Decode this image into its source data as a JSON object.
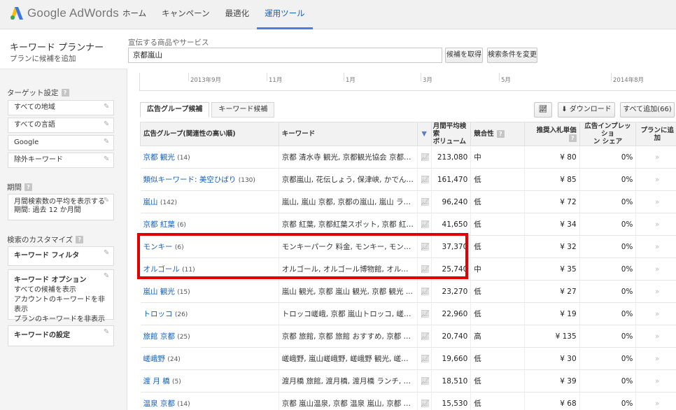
{
  "app": {
    "brand": "Google AdWords"
  },
  "nav": [
    "ホーム",
    "キャンペーン",
    "最適化",
    "運用ツール"
  ],
  "header": {
    "title": "キーワード プランナー",
    "subtitle": "プランに候補を追加",
    "search_label": "宣伝する商品やサービス",
    "search_value": "京都嵐山",
    "btn_get": "候補を取得",
    "btn_modify": "検索条件を変更"
  },
  "sidebar": {
    "targeting_label": "ターゲット設定",
    "targeting": [
      "すべての地域",
      "すべての言語",
      "Google",
      "除外キーワード"
    ],
    "period_label": "期間",
    "period_line1": "月間検索数の平均を表示する",
    "period_line2": "期間: 過去 12 か月間",
    "custom_label": "検索のカスタマイズ",
    "filter": "キーワード フィルタ",
    "options_title": "キーワード オプション",
    "options": [
      "すべての候補を表示",
      "アカウントのキーワードを非表示",
      "プランのキーワードを非表示"
    ],
    "settings": "キーワードの設定"
  },
  "timeline": [
    "2013年9月",
    "11月",
    "1月",
    "3月",
    "5月",
    "2014年8月"
  ],
  "tabs": [
    "広告グループ候補",
    "キーワード候補"
  ],
  "toolbar": {
    "download": "ダウンロード",
    "add_all": "すべて追加(66)"
  },
  "columns": {
    "group": "広告グループ(関連性の高い順)",
    "keywords": "キーワード",
    "volume1": "月間平均検索",
    "volume2": "ボリューム",
    "competition": "競合性",
    "bid": "推奨入札単価",
    "share1": "広告インプレッショ",
    "share2": "ン シェア",
    "add": "プランに追加"
  },
  "rows": [
    {
      "group": "京都 観光",
      "count": "(14)",
      "keywords": "京都 清水寺 観光, 京都観光協会 京都駅...",
      "volume": "213,080",
      "competition": "中",
      "bid": "¥ 80",
      "share": "0%"
    },
    {
      "group": "類似キーワード: 美空ひばり",
      "count": "(130)",
      "keywords": "京都嵐山, 花伝しょう, 保津峡, かでんしょ...",
      "volume": "161,470",
      "competition": "低",
      "bid": "¥ 85",
      "share": "0%"
    },
    {
      "group": "嵐山",
      "count": "(142)",
      "keywords": "嵐山, 嵐山 京都, 京都の嵐山, 嵐山 ライ...",
      "volume": "96,240",
      "competition": "低",
      "bid": "¥ 72",
      "share": "0%"
    },
    {
      "group": "京都 紅葉",
      "count": "(6)",
      "keywords": "京都 紅葉, 京都紅葉スポット, 京都 紅葉 ...",
      "volume": "41,650",
      "competition": "低",
      "bid": "¥ 34",
      "share": "0%"
    },
    {
      "group": "モンキー",
      "count": "(6)",
      "keywords": "モンキーパーク 料金, モンキー, モンキー...",
      "volume": "37,370",
      "competition": "低",
      "bid": "¥ 32",
      "share": "0%"
    },
    {
      "group": "オルゴール",
      "count": "(11)",
      "keywords": "オルゴール, オルゴール博物館, オルゴ...",
      "volume": "25,740",
      "competition": "中",
      "bid": "¥ 35",
      "share": "0%"
    },
    {
      "group": "嵐山 観光",
      "count": "(15)",
      "keywords": "嵐山 観光, 京都 嵐山 観光, 京都 観光 ...",
      "volume": "23,270",
      "competition": "低",
      "bid": "¥ 27",
      "share": "0%"
    },
    {
      "group": "トロッコ",
      "count": "(26)",
      "keywords": "トロッコ嵯峨, 京都 嵐山トロッコ, 嵯峨ト...",
      "volume": "22,960",
      "competition": "低",
      "bid": "¥ 19",
      "share": "0%"
    },
    {
      "group": "旅館 京都",
      "count": "(25)",
      "keywords": "京都 旅館, 京都 旅館 おすすめ, 京都 温...",
      "volume": "20,740",
      "competition": "高",
      "bid": "¥ 135",
      "share": "0%"
    },
    {
      "group": "嵯峨野",
      "count": "(24)",
      "keywords": "嵯峨野, 嵐山嵯峨野, 嵯峨野 観光, 嵯峨...",
      "volume": "19,660",
      "competition": "低",
      "bid": "¥ 30",
      "share": "0%"
    },
    {
      "group": "渡 月 橋",
      "count": "(5)",
      "keywords": "渡月橋 旅館, 渡月橋, 渡月橋 ランチ, 渡...",
      "volume": "18,510",
      "competition": "低",
      "bid": "¥ 39",
      "share": "0%"
    },
    {
      "group": "温泉 京都",
      "count": "(14)",
      "keywords": "京都 嵐山温泉, 京都 温泉 嵐山, 京都 温...",
      "volume": "15,530",
      "competition": "低",
      "bid": "¥ 68",
      "share": "0%"
    }
  ],
  "icons": {
    "trend": "trend-chart-icon",
    "chevron": "chevron-right-icon",
    "pencil": "pencil-icon",
    "help": "help-icon"
  },
  "colors": {
    "link": "#1a5fb4",
    "highlight": "#e00000",
    "active_tab": "#4a7ee0"
  }
}
